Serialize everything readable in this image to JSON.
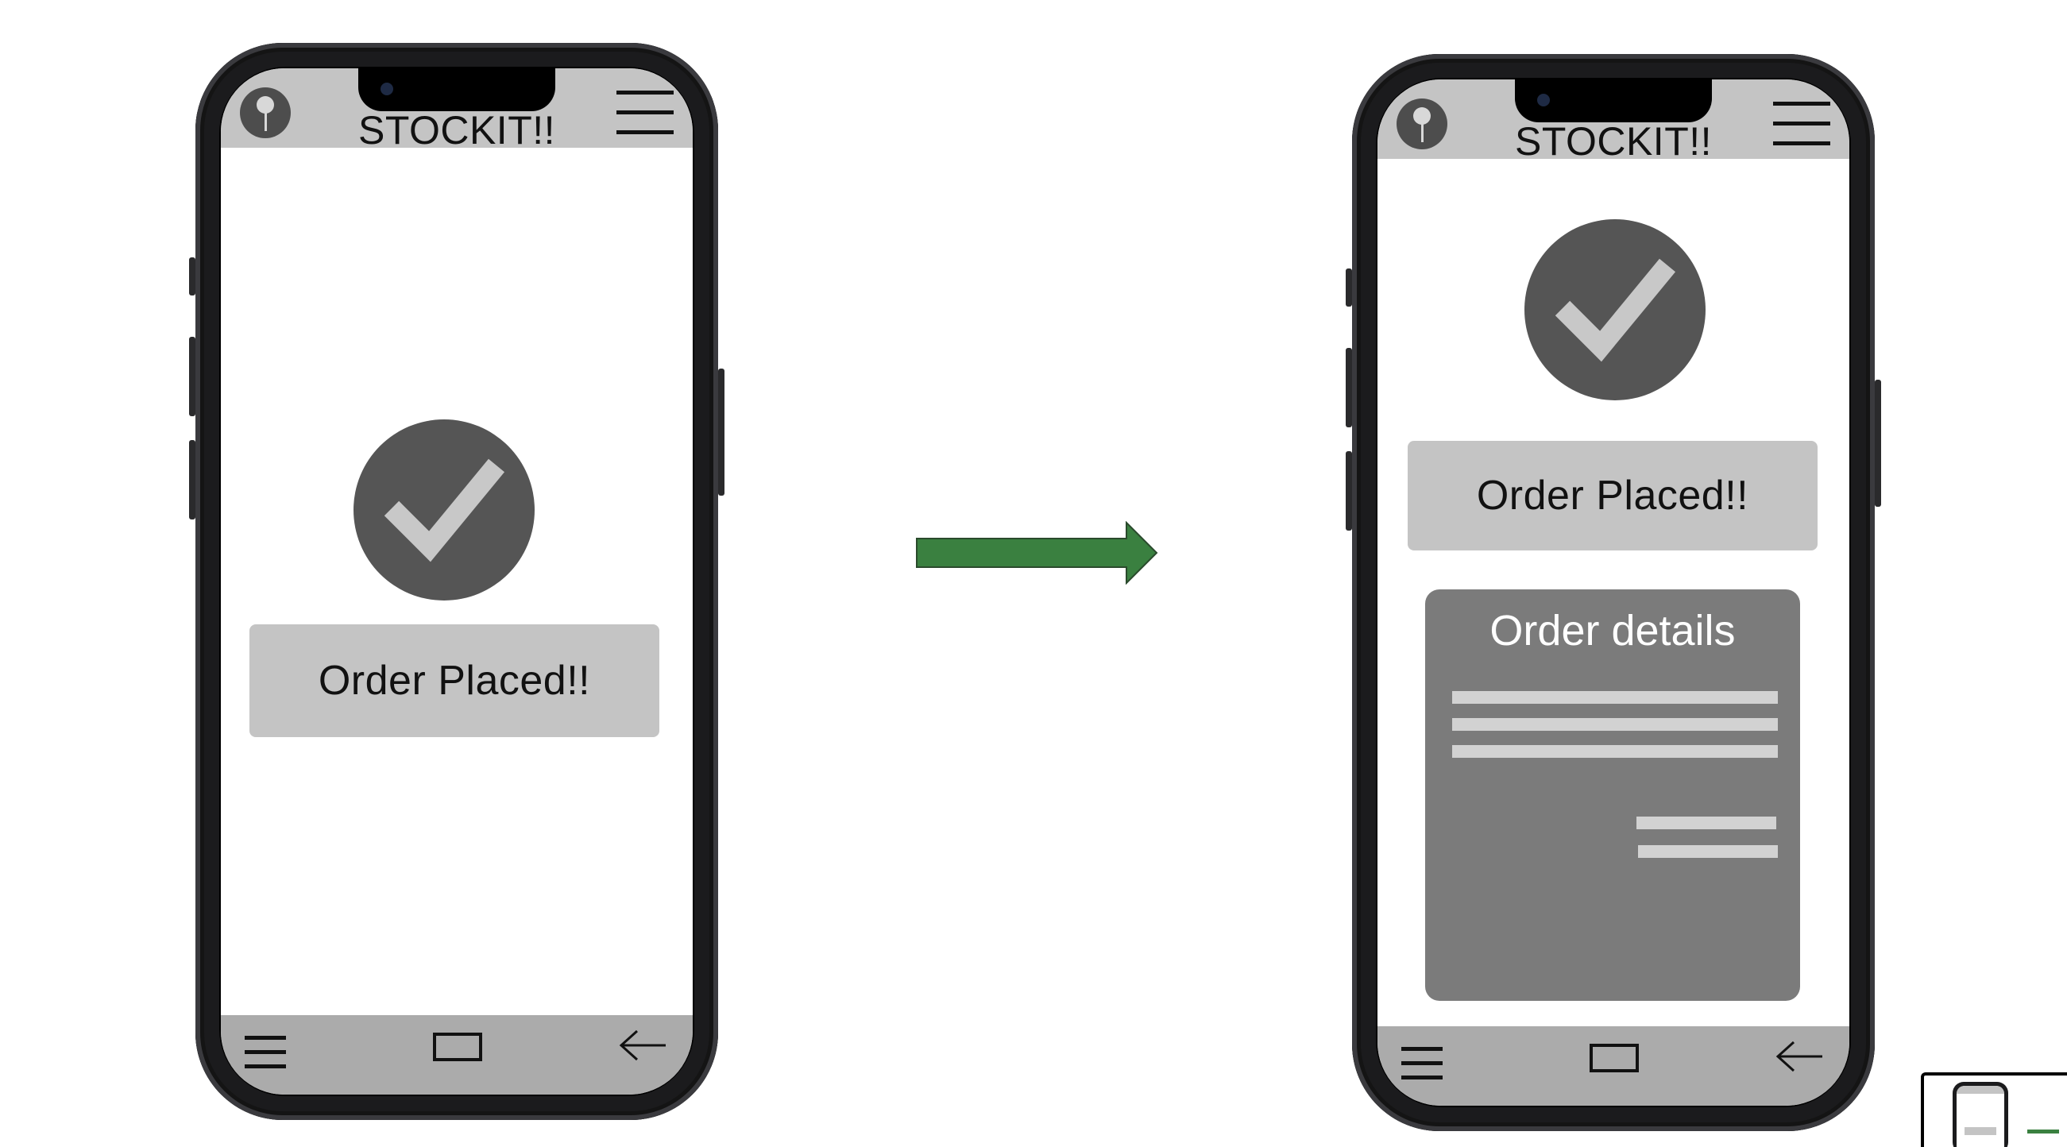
{
  "app": {
    "title": "STOCKIT!!"
  },
  "screens": [
    {
      "id": "confirmation",
      "status_label": "Order Placed!!"
    },
    {
      "id": "confirmation-with-details",
      "status_label": "Order Placed!!",
      "details_title": "Order details"
    }
  ],
  "icons": {
    "top_left": "map-pin-icon",
    "top_right": "hamburger-menu-icon",
    "status": "checkmark-icon",
    "nav_left": "menu-icon",
    "nav_center": "home-icon",
    "nav_right": "back-arrow-icon",
    "transition": "right-arrow-icon"
  },
  "colors": {
    "bar": "#c4c4c4",
    "nav_bar": "#ababab",
    "check_circle": "#555555",
    "card": "#7b7b7b",
    "arrow": "#3a8040"
  }
}
